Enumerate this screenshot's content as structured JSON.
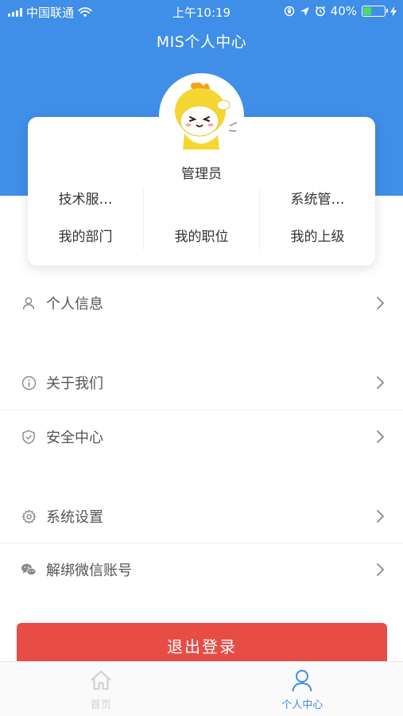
{
  "status_bar": {
    "carrier": "中国联通",
    "time": "上午10:19",
    "battery": "40%",
    "battery_level": 0.4
  },
  "header": {
    "title": "MIS个人中心"
  },
  "profile": {
    "name": "管理员",
    "stats": [
      {
        "value": "技术服…",
        "label": "我的部门"
      },
      {
        "value": "",
        "label": "我的职位"
      },
      {
        "value": "系统管…",
        "label": "我的上级"
      }
    ]
  },
  "menu": {
    "personal_info": "个人信息",
    "about_us": "关于我们",
    "security_center": "安全中心",
    "system_settings": "系统设置",
    "unbind_wechat": "解绑微信账号"
  },
  "logout_label": "退出登录",
  "tabbar": {
    "home": "首页",
    "me": "个人中心"
  },
  "colors": {
    "brand_blue": "#3f8ee8",
    "logout_red": "#e74c45",
    "battery_green": "#4cd964"
  }
}
